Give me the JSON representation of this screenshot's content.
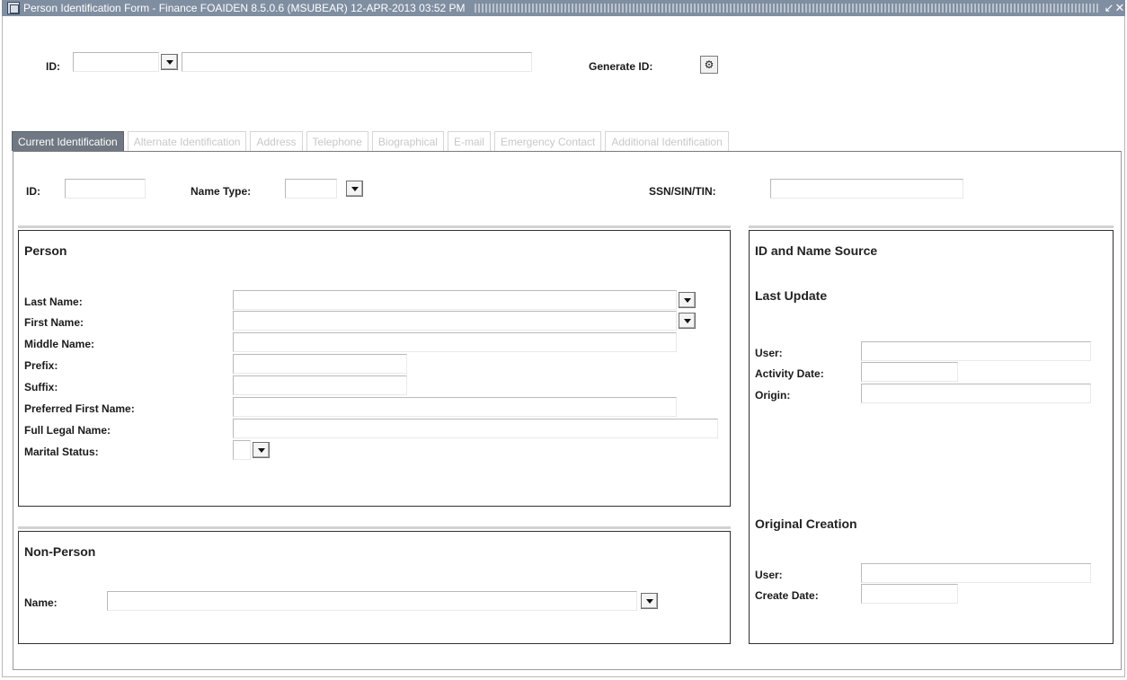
{
  "window": {
    "title": "Person Identification Form - Finance FOAIDEN 8.5.0.6 (MSUBEAR)    12-APR-2013 03:52 PM",
    "minimize_glyph": "↙",
    "close_glyph": "✕"
  },
  "key_block": {
    "id_label": "ID:",
    "id_value": "",
    "name_value": "",
    "generate_id_label": "Generate ID:",
    "generate_id_glyph": "⚙"
  },
  "tabs": [
    {
      "label": "Current Identification",
      "active": true
    },
    {
      "label": "Alternate Identification",
      "active": false
    },
    {
      "label": "Address",
      "active": false
    },
    {
      "label": "Telephone",
      "active": false
    },
    {
      "label": "Biographical",
      "active": false
    },
    {
      "label": "E-mail",
      "active": false
    },
    {
      "label": "Emergency Contact",
      "active": false
    },
    {
      "label": "Additional Identification",
      "active": false
    }
  ],
  "current_identification": {
    "id_label": "ID:",
    "id_value": "",
    "name_type_label": "Name Type:",
    "name_type_value": "",
    "ssn_label": "SSN/SIN/TIN:",
    "ssn_value": ""
  },
  "person": {
    "title": "Person",
    "last_name_label": "Last Name:",
    "first_name_label": "First Name:",
    "middle_name_label": "Middle Name:",
    "prefix_label": "Prefix:",
    "suffix_label": "Suffix:",
    "preferred_first_name_label": "Preferred First Name:",
    "full_legal_name_label": "Full Legal Name:",
    "marital_status_label": "Marital Status:"
  },
  "non_person": {
    "title": "Non-Person",
    "name_label": "Name:"
  },
  "id_name_source": {
    "title": "ID and Name Source",
    "last_update_title": "Last Update",
    "user_label": "User:",
    "activity_date_label": "Activity Date:",
    "origin_label": "Origin:",
    "original_creation_title": "Original Creation",
    "creation_user_label": "User:",
    "create_date_label": "Create Date:"
  }
}
